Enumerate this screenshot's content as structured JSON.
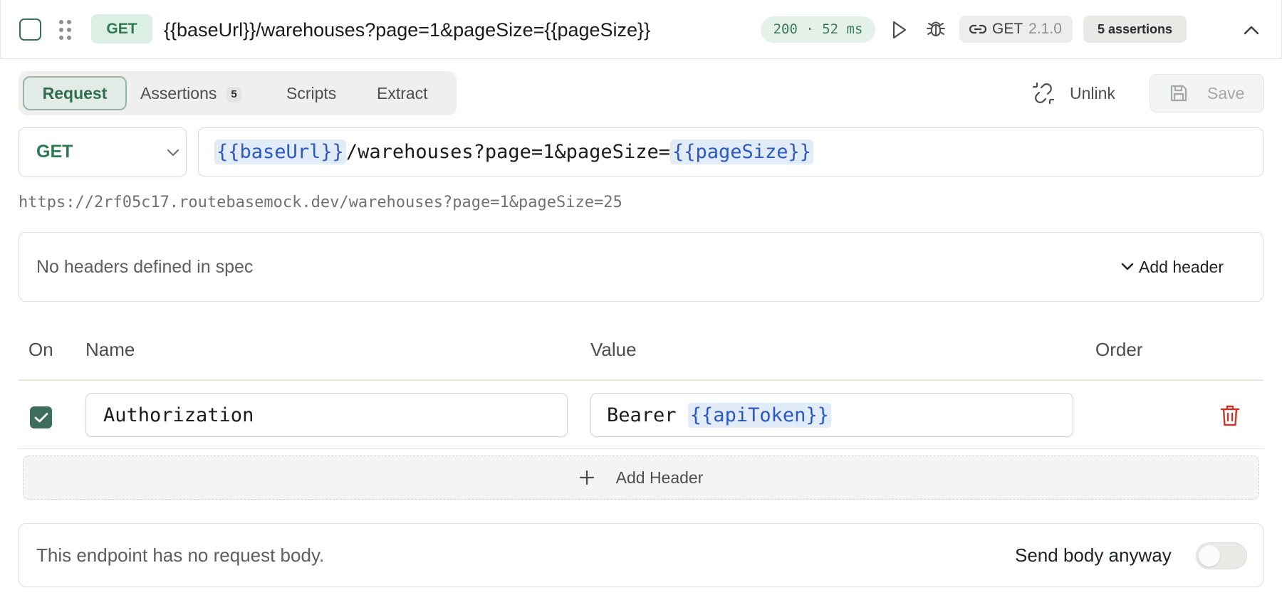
{
  "request": {
    "method": "GET",
    "title": "{{baseUrl}}/warehouses?page=1&pageSize={{pageSize}}",
    "status": "200 · 52 ms",
    "version_method": "GET",
    "version_number": "2.1.0",
    "assertions_badge": "5 assertions"
  },
  "tabs": {
    "request": "Request",
    "assertions": "Assertions",
    "assertions_count": "5",
    "scripts": "Scripts",
    "extract": "Extract"
  },
  "actions": {
    "unlink": "Unlink",
    "save": "Save"
  },
  "url": {
    "method": "GET",
    "var_base": "{{baseUrl}}",
    "path": "/warehouses?page=1&pageSize=",
    "var_page_size": "{{pageSize}}",
    "resolved": "https://2rf05c17.routebasemock.dev/warehouses?page=1&pageSize=25"
  },
  "spec_headers": {
    "message": "No headers defined in spec",
    "add_label": "Add header"
  },
  "headers_table": {
    "columns": [
      "On",
      "Name",
      "Value",
      "Order"
    ],
    "rows": [
      {
        "enabled": true,
        "name": "Authorization",
        "value_prefix": "Bearer ",
        "value_var": "{{apiToken}}"
      }
    ],
    "add_label": "Add Header"
  },
  "body": {
    "message": "This endpoint has no request body.",
    "send_anyway_label": "Send body anyway",
    "send_anyway": false
  },
  "colors": {
    "accent_green": "#2f7a52",
    "variable_blue": "#2b59c3",
    "delete_red": "#c0392b"
  },
  "icons": [
    "drag-handle-icon",
    "play-icon",
    "bug-icon",
    "link-icon",
    "chevron-up-icon",
    "unlink-icon",
    "save-icon",
    "chevron-down-icon",
    "check-icon",
    "trash-icon",
    "plus-icon"
  ]
}
